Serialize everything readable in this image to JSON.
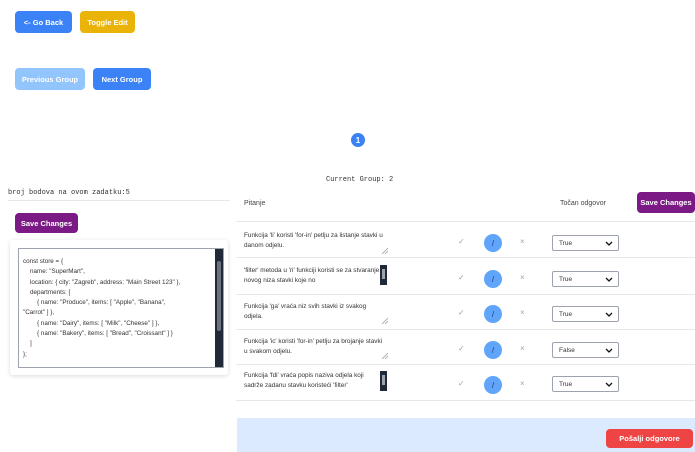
{
  "nav": {
    "go_back": "<- Go Back",
    "toggle_edit": "Toggle Edit",
    "previous_group": "Previous Group",
    "next_group": "Next Group"
  },
  "pagination": {
    "current_page": "1"
  },
  "current_group_label": "Current Group: 2",
  "points_label": "broj bodova na ovom zadatku:5",
  "left_panel": {
    "save_label": "Save Changes",
    "code": "const store = {\n    name: \"SuperMart\",\n    location: { city: \"Zagreb\", address: \"Main Street 123\" },\n    departments: [\n        { name: \"Produce\", items: [ \"Apple\", \"Banana\",\n\"Carrot\" ] },\n        { name: \"Dairy\", items: [ \"Milk\", \"Cheese\" ] },\n        { name: \"Bakery\", items: [ \"Bread\", \"Croissant\" ] }\n    ]\n};"
  },
  "table": {
    "col_question": "Pitanje",
    "col_answer": "Točan odgovor",
    "save_label": "Save Changes",
    "rows": [
      {
        "question": "Funkcija 'li' koristi 'for-in' petlju za listanje stavki u danom odjelu.",
        "answer": "True"
      },
      {
        "question": "'filter' metoda u 'ri' funkciji koristi se za stvaranje novog niza stavki koje no",
        "answer": "True"
      },
      {
        "question": "Funkcija 'ga' vraća niz svih stavki iz svakog odjela.",
        "answer": "True"
      },
      {
        "question": "Funkcija 'ic' koristi 'for-in' petlju za brojanje stavki u svakom odjelu.",
        "answer": "False"
      },
      {
        "question": "Funkcija 'fdi' vraća popis naziva odjela koji sadrže zadanu stavku koristeći 'filter'",
        "answer": "True"
      }
    ],
    "check_symbol": "✓",
    "slash_symbol": "/",
    "cross_symbol": "×"
  },
  "submit_label": "Pošalji odgovore",
  "colors": {
    "primary": "#3b82f6",
    "primary_disabled": "#93c5fd",
    "warning": "#eab308",
    "purple": "#7c1a85",
    "danger": "#ef4444",
    "footer_bg": "#dbeafe"
  }
}
